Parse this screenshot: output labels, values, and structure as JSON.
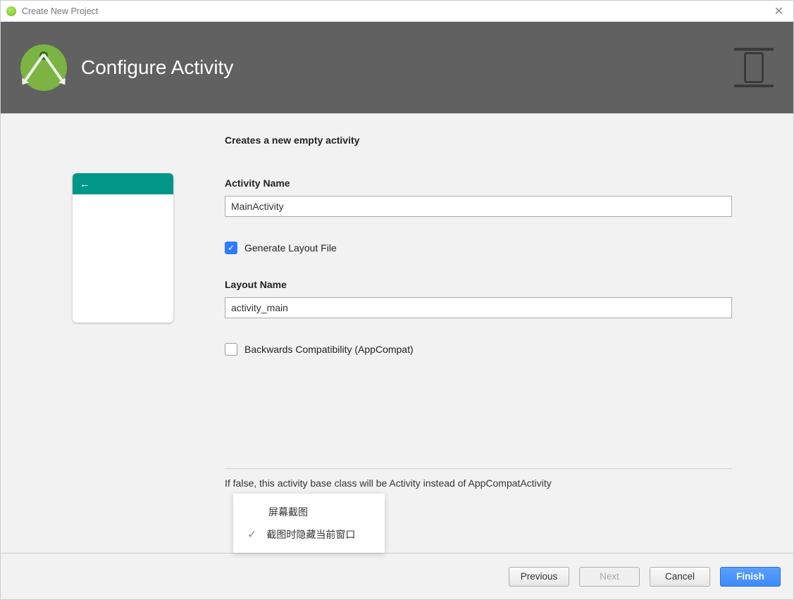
{
  "titlebar": {
    "title": "Create New Project"
  },
  "header": {
    "heading": "Configure Activity"
  },
  "description": "Creates a new empty activity",
  "fields": {
    "activity_name": {
      "label": "Activity Name",
      "value": "MainActivity"
    },
    "generate_layout": {
      "label": "Generate Layout File",
      "checked": true
    },
    "layout_name": {
      "label": "Layout Name",
      "value": "activity_main"
    },
    "backwards_compat": {
      "label": "Backwards Compatibility (AppCompat)",
      "checked": false
    }
  },
  "popup": {
    "title": "屏幕截图",
    "option": "截图时隐藏当前窗口"
  },
  "help": "If false, this activity base class will be Activity instead of AppCompatActivity",
  "buttons": {
    "previous": "Previous",
    "next": "Next",
    "cancel": "Cancel",
    "finish": "Finish"
  }
}
